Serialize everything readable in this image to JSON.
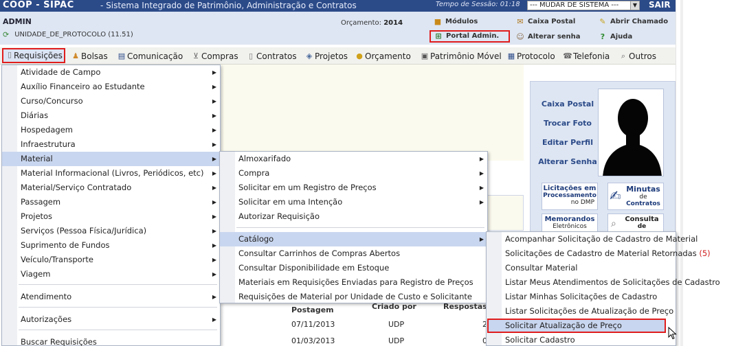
{
  "header": {
    "app_name": "COOP - SIPAC",
    "subtitle": "- Sistema Integrado de Patrimônio, Administração e Contratos",
    "session_label": "Tempo de Sessão: 01:18",
    "change_system": "--- MUDAR DE SISTEMA ---",
    "logout": "SAIR"
  },
  "info": {
    "user": "ADMIN",
    "unit": "UNIDADE_DE_PROTOCOLO (11.51)",
    "budget_label": "Orçamento:",
    "budget_year": "2014",
    "quick": {
      "modulos": "Módulos",
      "caixa_postal": "Caixa Postal",
      "abrir_chamado": "Abrir Chamado",
      "portal_admin": "Portal Admin.",
      "alterar_senha": "Alterar senha",
      "ajuda": "Ajuda"
    }
  },
  "menubar": {
    "requisicoes": "Requisições",
    "bolsas": "Bolsas",
    "comunicacao": "Comunicação",
    "compras": "Compras",
    "contratos": "Contratos",
    "projetos": "Projetos",
    "orcamento": "Orçamento",
    "patrimonio": "Patrimônio Móvel",
    "protocolo": "Protocolo",
    "telefonia": "Telefonia",
    "outros": "Outros"
  },
  "menu1": {
    "items": [
      "Atividade de Campo",
      "Auxílio Financeiro ao Estudante",
      "Curso/Concurso",
      "Diárias",
      "Hospedagem",
      "Infraestrutura",
      "Material",
      "Material Informacional (Livros, Periódicos, etc)",
      "Material/Serviço Contratado",
      "Passagem",
      "Projetos",
      "Serviços (Pessoa Física/Jurídica)",
      "Suprimento de Fundos",
      "Veículo/Transporte",
      "Viagem",
      "Atendimento",
      "Autorizações",
      "Buscar Requisições"
    ]
  },
  "menu2": {
    "items": [
      "Almoxarifado",
      "Compra",
      "Solicitar em um Registro de Preços",
      "Solicitar em uma Intenção",
      "Autorizar Requisição",
      "Catálogo",
      "Consultar Carrinhos de Compras Abertos",
      "Consultar Disponibilidade em Estoque",
      "Materiais em Requisições Enviadas para Registro de Preços",
      "Requisições de Material por Unidade de Custo e Solicitante"
    ]
  },
  "menu3": {
    "items": [
      "Acompanhar Solicitação de Cadastro de Material",
      "Solicitações de Cadastro de Material Retornadas",
      "Consultar Material",
      "Listar Meus Atendimentos de Solicitações de Cadastro",
      "Listar Minhas Solicitações de Cadastro",
      "Listar Solicitações de Atualização de Preço",
      "Solicitar Atualização de Preço",
      "Solicitar Cadastro"
    ],
    "returned_count": "(5)"
  },
  "table": {
    "col_postagem": "Postagem",
    "col_criado_por": "Criado por",
    "col_respostas": "Respostas",
    "rows": [
      {
        "date": "07/11/2013",
        "by": "UDP",
        "replies": "2"
      },
      {
        "date": "01/03/2013",
        "by": "UDP",
        "replies": "0"
      }
    ]
  },
  "profile": {
    "caixa_postal": "Caixa Postal",
    "trocar_foto": "Trocar Foto",
    "editar_perfil": "Editar Perfil",
    "alterar_senha": "Alterar Senha",
    "tiles": {
      "licitacoes_1": "Licitações em",
      "licitacoes_2": "Processamento",
      "licitacoes_3": "no DMP",
      "minutas_1": "Minutas",
      "minutas_2": "de",
      "minutas_3": "Contratos",
      "memorandos_1": "Memorandos",
      "memorandos_2": "Eletrônicos",
      "consulta_1": "Consulta",
      "consulta_2": "de"
    }
  },
  "colors": {
    "header_bg": "#2b4a88",
    "info_bg": "#dee6f3",
    "highlight_border": "#e01c1c",
    "menu_selected": "#c9d6ef"
  }
}
